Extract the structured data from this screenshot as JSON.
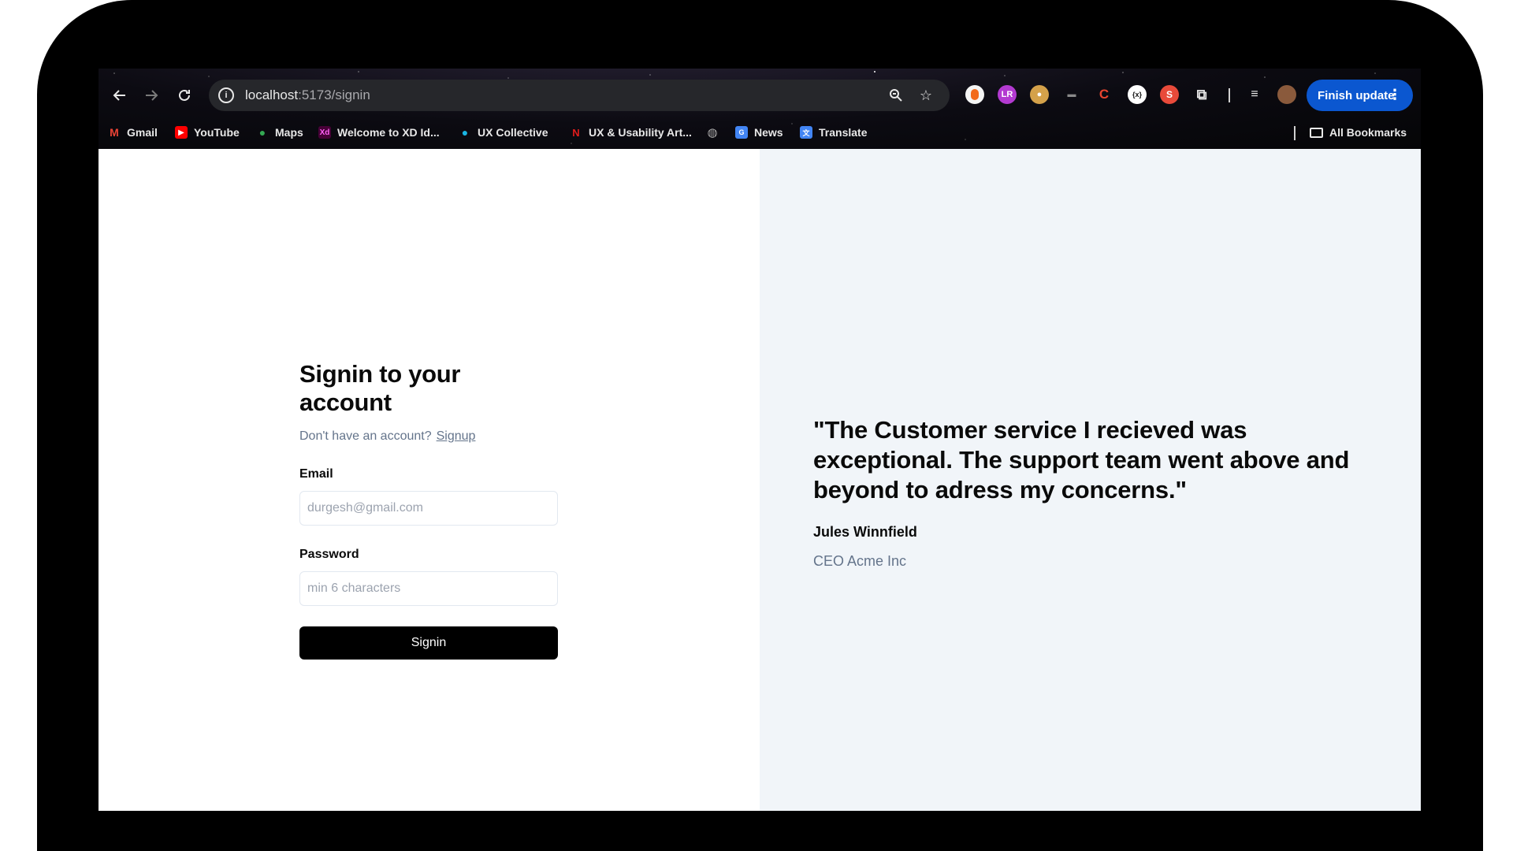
{
  "browser": {
    "url_host": "localhost",
    "url_path": ":5173/signin",
    "finish_update_label": "Finish update",
    "bookmarks": [
      {
        "label": "Gmail",
        "icon": "gmail-icon"
      },
      {
        "label": "YouTube",
        "icon": "youtube-icon"
      },
      {
        "label": "Maps",
        "icon": "maps-icon"
      },
      {
        "label": "Welcome to XD Id...",
        "icon": "adobe-xd-icon"
      },
      {
        "label": "UX Collective",
        "icon": "ux-collective-icon"
      },
      {
        "label": "UX & Usability Art...",
        "icon": "nng-icon"
      },
      {
        "label": "",
        "icon": "globe-icon"
      },
      {
        "label": "News",
        "icon": "news-icon"
      },
      {
        "label": "Translate",
        "icon": "translate-icon"
      }
    ],
    "all_bookmarks_label": "All Bookmarks",
    "accent_color": "#0b57d0"
  },
  "signin": {
    "title": "Signin to your account",
    "prompt": "Don't have an account?",
    "signup_link": "Signup",
    "email_label": "Email",
    "email_placeholder": "durgesh@gmail.com",
    "password_label": "Password",
    "password_placeholder": "min 6 characters",
    "submit_label": "Signin"
  },
  "testimonial": {
    "quote": "\"The Customer service I recieved was exceptional. The support team went above and beyond to adress my concerns.\"",
    "author": "Jules Winnfield",
    "role": "CEO Acme Inc"
  }
}
